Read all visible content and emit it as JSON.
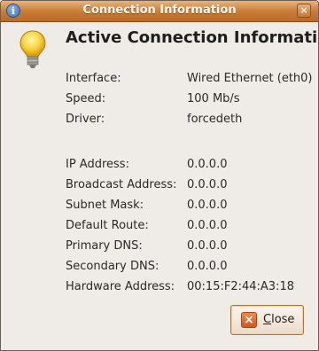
{
  "window": {
    "title": "Connection Information",
    "title_icon": "info-icon",
    "close_glyph": "×"
  },
  "header": {
    "icon": "lightbulb-icon",
    "title": "Active Connection Information"
  },
  "details": [
    {
      "label": "Interface:",
      "value": "Wired Ethernet (eth0)"
    },
    {
      "label": "Speed:",
      "value": "100 Mb/s"
    },
    {
      "label": "Driver:",
      "value": "forcedeth"
    },
    {
      "label": "IP Address:",
      "value": "0.0.0.0"
    },
    {
      "label": "Broadcast Address:",
      "value": "0.0.0.0"
    },
    {
      "label": "Subnet Mask:",
      "value": "0.0.0.0"
    },
    {
      "label": "Default Route:",
      "value": "0.0.0.0"
    },
    {
      "label": "Primary DNS:",
      "value": "0.0.0.0"
    },
    {
      "label": "Secondary DNS:",
      "value": "0.0.0.0"
    },
    {
      "label": "Hardware Address:",
      "value": "00:15:F2:44:A3:18"
    }
  ],
  "buttons": {
    "close_mnemonic": "C",
    "close_rest": "lose",
    "close_icon_glyph": "×"
  },
  "colors": {
    "titlebar": "#c97e3a",
    "background": "#efebe7",
    "close_icon": "#d4561e"
  }
}
